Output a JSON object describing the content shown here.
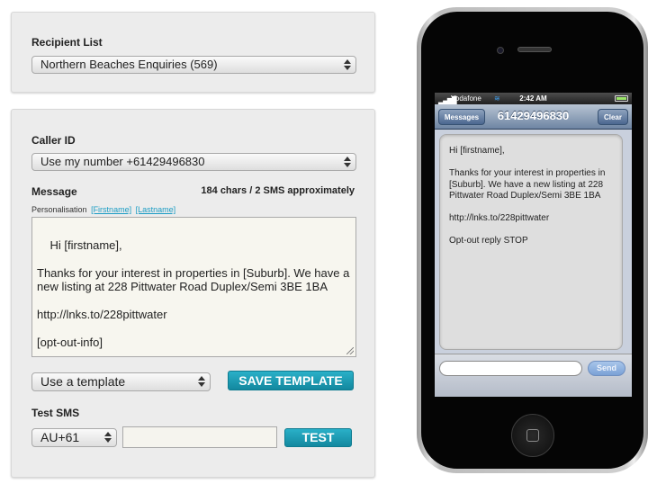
{
  "recipient": {
    "label": "Recipient List",
    "selected": "Northern Beaches Enquiries (569)"
  },
  "compose": {
    "caller_id_label": "Caller ID",
    "caller_id_value": "Use my number +61429496830",
    "message_label": "Message",
    "char_count": "184 chars / 2 SMS approximately",
    "personalisation_label": "Personalisation",
    "tokens": [
      "[Firstname]",
      "[Lastname]"
    ],
    "message_text": "Hi [firstname],\n\nThanks for your interest in properties in [Suburb]. We have a new listing at 228 Pittwater Road Duplex/Semi 3BE 1BA\n\nhttp://lnks.to/228pittwater\n\n[opt-out-info]",
    "template_select": "Use a template",
    "save_template": "SAVE TEMPLATE",
    "test_sms_label": "Test SMS",
    "country_code": "AU+61",
    "test_button": "TEST"
  },
  "phone": {
    "carrier": "Vodafone",
    "time": "2:42 AM",
    "back_button": "Messages",
    "title": "61429496830",
    "clear_button": "Clear",
    "preview_text": "Hi [firstname],\n\nThanks for your interest in properties in [Suburb]. We have a new listing at 228 Pittwater Road Duplex/Semi 3BE 1BA\n\nhttp://lnks.to/228pittwater\n\nOpt-out reply STOP",
    "send_button": "Send"
  },
  "colors": {
    "accent": "#1a9cc4",
    "button": "#13889f",
    "panel": "#ececec"
  }
}
